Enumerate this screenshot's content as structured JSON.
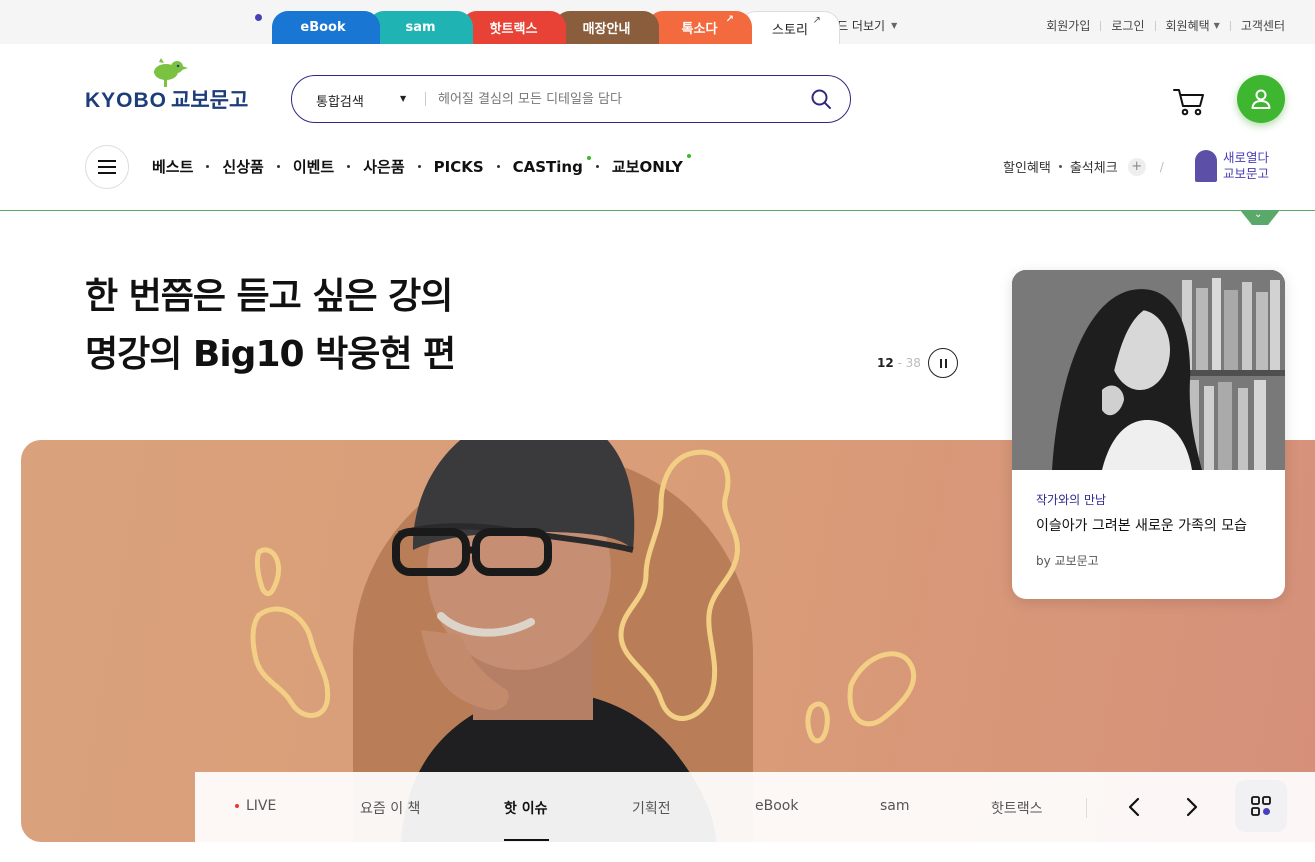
{
  "brand_tabs": {
    "ebook": "eBook",
    "sam": "sam",
    "hottracks": "핫트랙스",
    "store": "매장안내",
    "toksoda": "톡소다",
    "story": "스토리",
    "external_mark": "↗"
  },
  "brand_more": "브랜드 더보기",
  "util_links": {
    "join": "회원가입",
    "login": "로그인",
    "benefits": "회원혜택",
    "service": "고객센터"
  },
  "logo": {
    "latin": "KYOBO",
    "korean": "교보문고"
  },
  "search": {
    "scope": "통합검색",
    "placeholder": "헤어질 결심의 모든 디테일을 담다"
  },
  "gnb": [
    "베스트",
    "신상품",
    "이벤트",
    "사은품",
    "PICKS",
    "CASTing",
    "교보ONLY"
  ],
  "benefit_links": {
    "discount": "할인혜택",
    "attendance": "출석체크",
    "plus": "+",
    "slash": "/"
  },
  "new_open": {
    "line1": "새로열다",
    "line2": "교보문고"
  },
  "hero": {
    "title_line1": "한 번쯤은 듣고 싶은 강의",
    "title_line2": "명강의 Big10 박웅현 편",
    "current": "12",
    "separator": " - ",
    "total": "38"
  },
  "side_card": {
    "category": "작가와의 만남",
    "title": "이슬아가 그려본 새로운 가족의 모습",
    "by": "by 교보문고"
  },
  "bottom_tabs": [
    "LIVE",
    "요즘 이 책",
    "핫 이슈",
    "기획전",
    "eBook",
    "sam",
    "핫트랙스"
  ],
  "active_tab": "핫 이슈",
  "colors": {
    "brand_navy": "#1d3c7a",
    "accent_green": "#3fb62f",
    "search_border": "#2f2a80",
    "banner_bg": "#d99c78"
  },
  "icons": [
    "search-icon",
    "cart-icon",
    "user-icon",
    "hamburger-icon",
    "pause-icon",
    "chevron-left-icon",
    "chevron-right-icon",
    "grid-icon",
    "chevron-down-icon"
  ]
}
